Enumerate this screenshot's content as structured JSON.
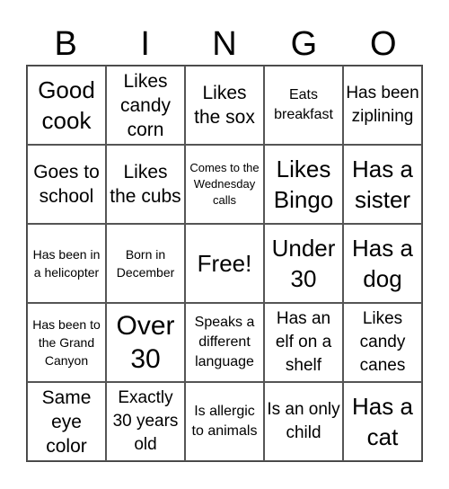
{
  "header": {
    "letters": [
      "B",
      "I",
      "N",
      "G",
      "O"
    ]
  },
  "cells": [
    [
      "Good cook",
      "Likes candy corn",
      "Likes the sox",
      "Eats breakfast",
      "Has been ziplining"
    ],
    [
      "Goes to school",
      "Likes the cubs",
      "Comes to the Wednesday calls",
      "Likes Bingo",
      "Has a sister"
    ],
    [
      "Has been in a helicopter",
      "Born in December",
      "Free!",
      "Under 30",
      "Has a dog"
    ],
    [
      "Has been to the Grand Canyon",
      "Over 30",
      "Speaks a different language",
      "Has an elf on a shelf",
      "Likes candy canes"
    ],
    [
      "Same eye color",
      "Exactly 30 years old",
      "Is allergic to animals",
      "Is an only child",
      "Has a cat"
    ]
  ]
}
